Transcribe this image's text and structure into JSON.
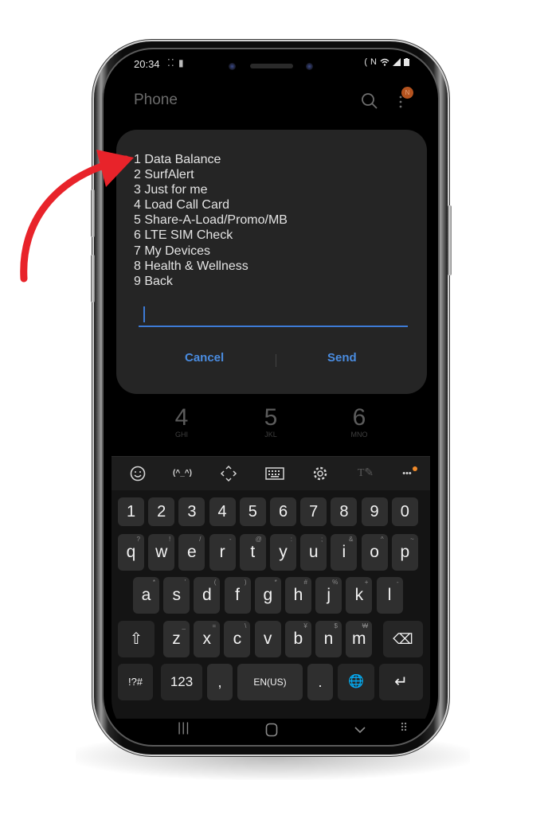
{
  "status_bar": {
    "time": "20:34",
    "notification_icons": "⁚⁚ ▮",
    "right_icons": [
      "nfc-icon",
      "vibrate-icon",
      "wifi-icon",
      "signal-icon",
      "battery-icon"
    ]
  },
  "app_bar": {
    "title": "Phone",
    "search_icon": "search-icon",
    "more_icon": "more-vert-icon",
    "avatar_initial": "N"
  },
  "ussd_dialog": {
    "menu_items": [
      "1 Data Balance",
      "2 SurfAlert",
      "3 Just for me",
      "4 Load Call Card",
      "5 Share-A-Load/Promo/MB",
      "6 LTE SIM Check",
      "7 My Devices",
      "8 Health & Wellness",
      "9 Back"
    ],
    "input_value": "",
    "cancel_label": "Cancel",
    "send_label": "Send",
    "accent_color": "#4a8ce0"
  },
  "dialpad_partial": [
    {
      "digit": "4",
      "letters": "GHI"
    },
    {
      "digit": "5",
      "letters": "JKL"
    },
    {
      "digit": "6",
      "letters": "MNO"
    }
  ],
  "keyboard": {
    "toolbar": [
      {
        "name": "emoji-icon",
        "glyph": "☺"
      },
      {
        "name": "kaomoji-icon",
        "glyph": "(^_^)"
      },
      {
        "name": "cursor-move-icon",
        "glyph": "‹›"
      },
      {
        "name": "keyboard-icon",
        "glyph": "⌨"
      },
      {
        "name": "settings-icon",
        "glyph": "⚙"
      },
      {
        "name": "handwriting-icon",
        "glyph": "T✎"
      },
      {
        "name": "more-horizontal-icon",
        "glyph": "•••"
      }
    ],
    "number_row": [
      "1",
      "2",
      "3",
      "4",
      "5",
      "6",
      "7",
      "8",
      "9",
      "0"
    ],
    "row1": [
      {
        "key": "q",
        "hint": "?"
      },
      {
        "key": "w",
        "hint": "!"
      },
      {
        "key": "e",
        "hint": "/"
      },
      {
        "key": "r",
        "hint": "-"
      },
      {
        "key": "t",
        "hint": "@"
      },
      {
        "key": "y",
        "hint": ":"
      },
      {
        "key": "u",
        "hint": ";"
      },
      {
        "key": "i",
        "hint": "&"
      },
      {
        "key": "o",
        "hint": "^"
      },
      {
        "key": "p",
        "hint": "~"
      }
    ],
    "row2": [
      {
        "key": "a",
        "hint": "*"
      },
      {
        "key": "s",
        "hint": "'"
      },
      {
        "key": "d",
        "hint": "("
      },
      {
        "key": "f",
        "hint": ")"
      },
      {
        "key": "g",
        "hint": "*"
      },
      {
        "key": "h",
        "hint": "#"
      },
      {
        "key": "j",
        "hint": "%"
      },
      {
        "key": "k",
        "hint": "+"
      },
      {
        "key": "l",
        "hint": "-"
      }
    ],
    "row3": [
      {
        "key": "z",
        "hint": "_"
      },
      {
        "key": "x",
        "hint": "="
      },
      {
        "key": "c",
        "hint": "\\"
      },
      {
        "key": "v",
        "hint": ""
      },
      {
        "key": "b",
        "hint": "¥"
      },
      {
        "key": "n",
        "hint": "$"
      },
      {
        "key": "m",
        "hint": "₩"
      }
    ],
    "shift_glyph": "⇧",
    "backspace_glyph": "⌫",
    "symbols_label": "!?#",
    "numbers_label": "123",
    "comma_label": ",",
    "space_label": "EN(US)",
    "period_label": ".",
    "globe_glyph": "🌐",
    "enter_glyph": "↵"
  },
  "nav_bar": {
    "recents_glyph": "|||",
    "home_glyph": "▢",
    "back_glyph": "⌄",
    "keyboard_switch_glyph": "⠿"
  },
  "annotation": {
    "arrow_color": "#e8232a"
  }
}
